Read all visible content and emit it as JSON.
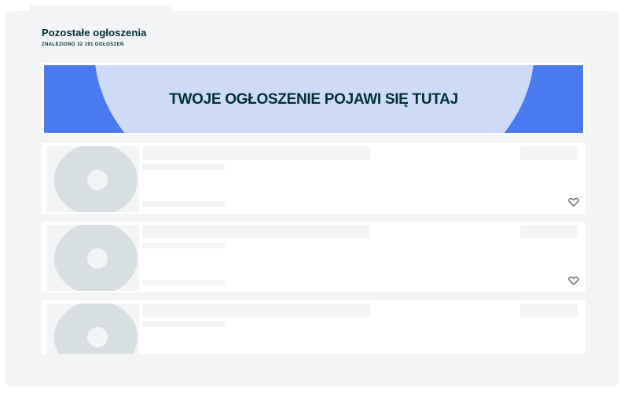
{
  "section": {
    "title": "Pozostałe ogłoszenia",
    "count": "ZNALEZIONO 32 191 OGŁOSZEŃ"
  },
  "banner": {
    "text": "TWOJE OGŁOSZENIE POJAWI SIĘ TUTAJ",
    "colors": {
      "background": "#4a7af2",
      "arc": "#cddbf8",
      "text": "#002f34"
    }
  },
  "listings": [
    {
      "favorite_icon": "heart-outline-icon"
    },
    {
      "favorite_icon": "heart-outline-icon"
    },
    {
      "favorite_icon": "heart-outline-icon"
    }
  ]
}
